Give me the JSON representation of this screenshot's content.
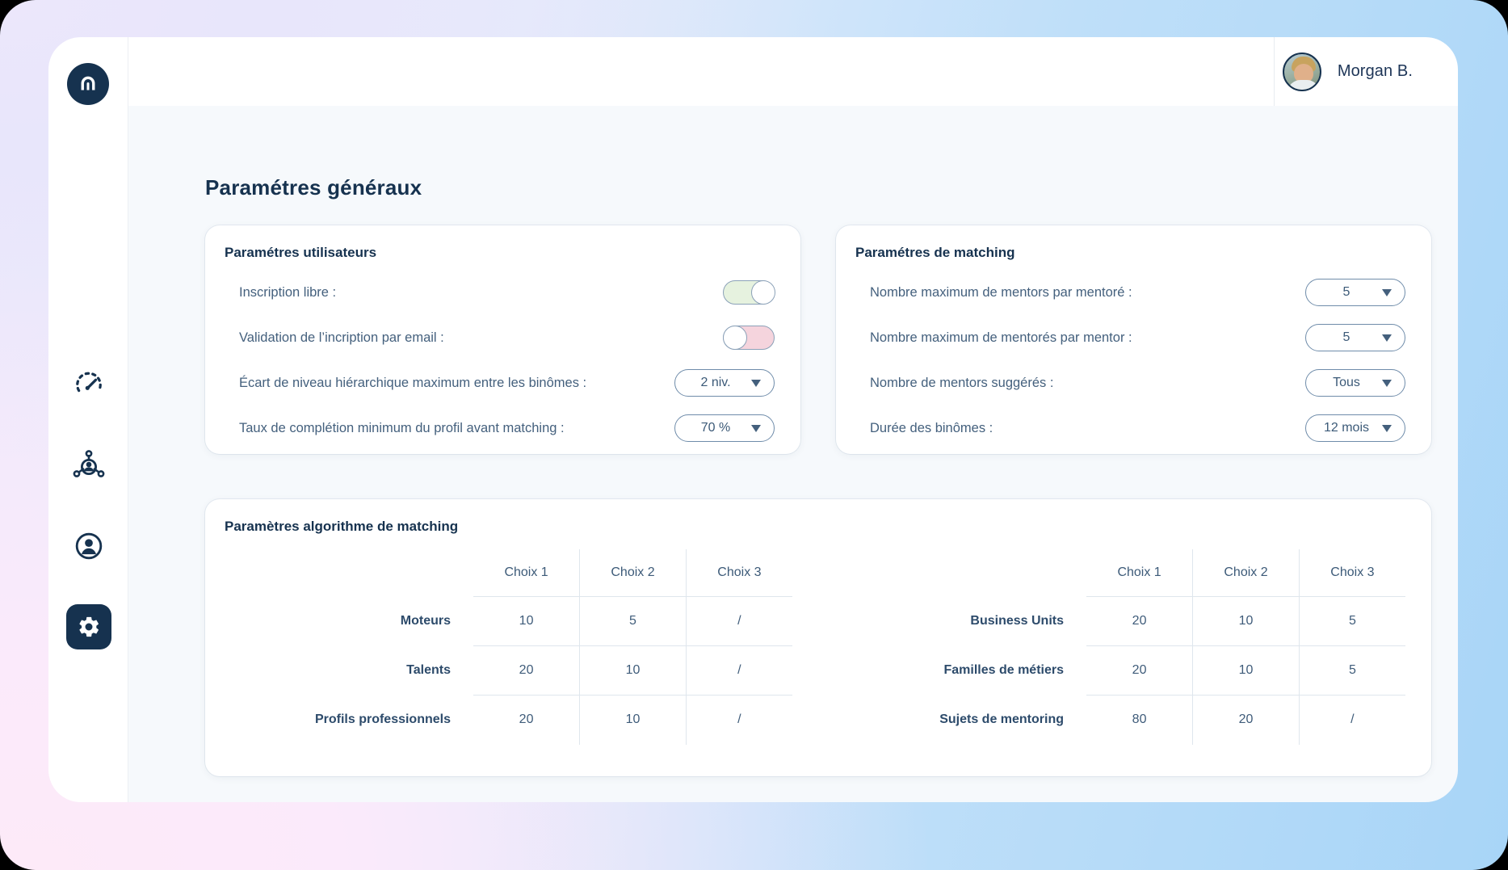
{
  "brand": {
    "logo_text": "m",
    "logo_color": "#16324f"
  },
  "topbar": {
    "user_name": "Morgan B."
  },
  "sidebar": {
    "items": [
      {
        "icon": "speedometer-icon",
        "name": "dashboard",
        "active": false
      },
      {
        "icon": "network-user-icon",
        "name": "matching",
        "active": false
      },
      {
        "icon": "user-circle-icon",
        "name": "profile",
        "active": false
      },
      {
        "icon": "gear-icon",
        "name": "settings",
        "active": true
      }
    ]
  },
  "page": {
    "title": "Paramétres généraux"
  },
  "cards": {
    "users": {
      "title": "Paramétres utilisateurs",
      "rows": [
        {
          "label": "Inscription libre :",
          "control": "toggle",
          "state": "on",
          "color": "#e6f2df"
        },
        {
          "label": "Validation de l’incription par email :",
          "control": "toggle",
          "state": "off",
          "color": "#f5d4dd"
        },
        {
          "label": "Écart de niveau hiérarchique maximum entre les binômes :",
          "control": "dropdown",
          "value": "2 niv."
        },
        {
          "label": "Taux de complétion minimum du profil avant matching :",
          "control": "dropdown",
          "value": "70 %"
        }
      ]
    },
    "matching": {
      "title": "Paramétres de matching",
      "rows": [
        {
          "label": "Nombre maximum de mentors par mentoré :",
          "control": "dropdown",
          "value": "5"
        },
        {
          "label": "Nombre maximum de mentorés par mentor :",
          "control": "dropdown",
          "value": "5"
        },
        {
          "label": "Nombre de mentors suggérés :",
          "control": "dropdown",
          "value": "Tous"
        },
        {
          "label": "Durée des binômes :",
          "control": "dropdown",
          "value": "12 mois"
        }
      ]
    },
    "algo": {
      "title": "Paramètres algorithme de matching",
      "tables": [
        {
          "headers": [
            "Choix 1",
            "Choix 2",
            "Choix 3"
          ],
          "rows": [
            {
              "label": "Moteurs",
              "values": [
                "10",
                "5",
                "/"
              ]
            },
            {
              "label": "Talents",
              "values": [
                "20",
                "10",
                "/"
              ]
            },
            {
              "label": "Profils professionnels",
              "values": [
                "20",
                "10",
                "/"
              ]
            }
          ]
        },
        {
          "headers": [
            "Choix 1",
            "Choix 2",
            "Choix 3"
          ],
          "rows": [
            {
              "label": "Business Units",
              "values": [
                "20",
                "10",
                "5"
              ]
            },
            {
              "label": "Familles de métiers",
              "values": [
                "20",
                "10",
                "5"
              ]
            },
            {
              "label": "Sujets de mentoring",
              "values": [
                "80",
                "20",
                "/"
              ]
            }
          ]
        }
      ]
    }
  }
}
